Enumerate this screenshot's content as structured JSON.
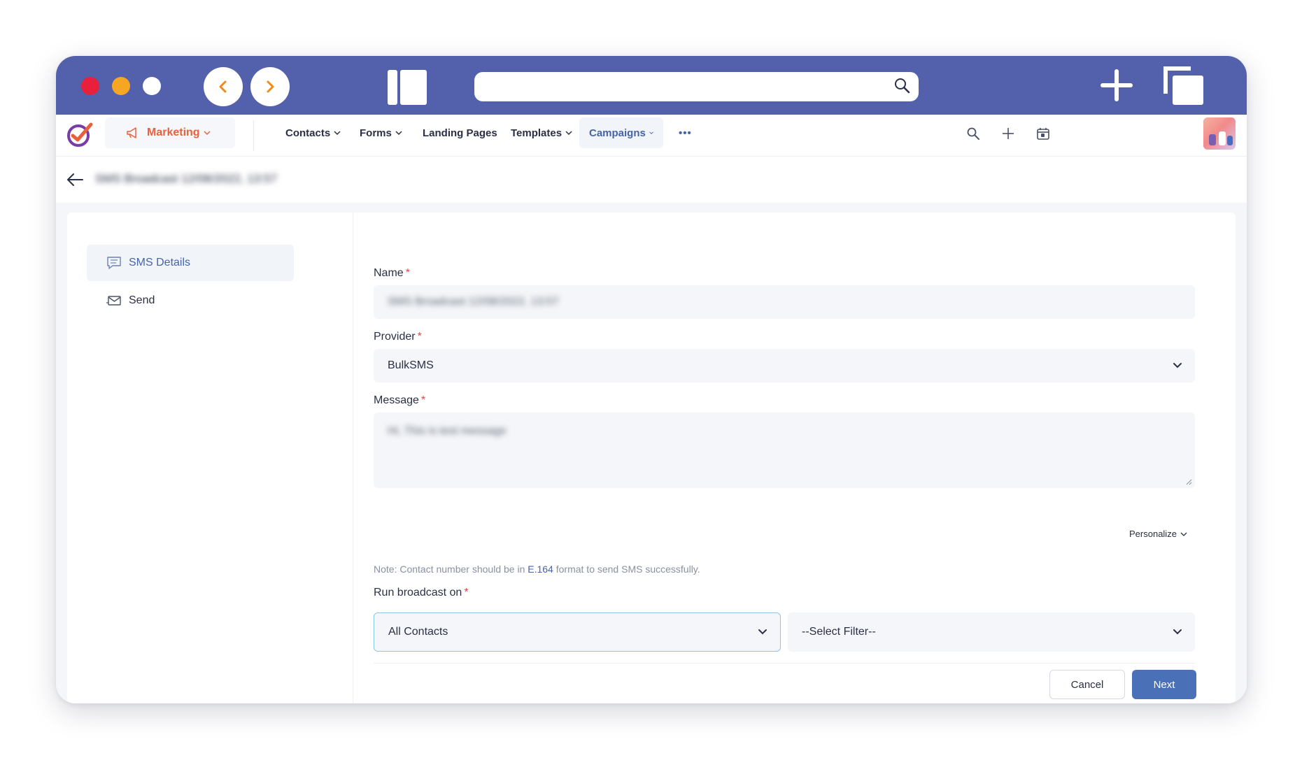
{
  "nav": {
    "module_label": "Marketing",
    "items": [
      {
        "label": "Contacts"
      },
      {
        "label": "Forms"
      },
      {
        "label": "Landing Pages"
      },
      {
        "label": "Templates"
      },
      {
        "label": "Campaigns"
      }
    ],
    "more_label": "•••"
  },
  "page": {
    "title": "SMS Broadcast 12/08/2022, 13:57"
  },
  "sidebar": {
    "items": [
      {
        "label": "SMS Details",
        "icon": "chat-icon",
        "active": true
      },
      {
        "label": "Send",
        "icon": "envelope-icon",
        "active": false
      }
    ]
  },
  "form": {
    "name_label": "Name",
    "name_value": "SMS Broadcast 12/08/2022, 13:57",
    "provider_label": "Provider",
    "provider_value": "BulkSMS",
    "message_label": "Message",
    "message_value": "Hi, This is test message",
    "personalize_label": "Personalize",
    "note_prefix": "Note: Contact number should be in ",
    "note_link": "E.164",
    "note_suffix": " format to send SMS successfully.",
    "run_label": "Run broadcast on",
    "run_value": "All Contacts",
    "filter_value": "--Select Filter--",
    "required_mark": "*"
  },
  "actions": {
    "cancel_label": "Cancel",
    "next_label": "Next"
  },
  "colors": {
    "titlebar": "#5360ac",
    "accent": "#4664a8",
    "marketing": "#e8603c",
    "primary_button": "#4a70b8"
  }
}
